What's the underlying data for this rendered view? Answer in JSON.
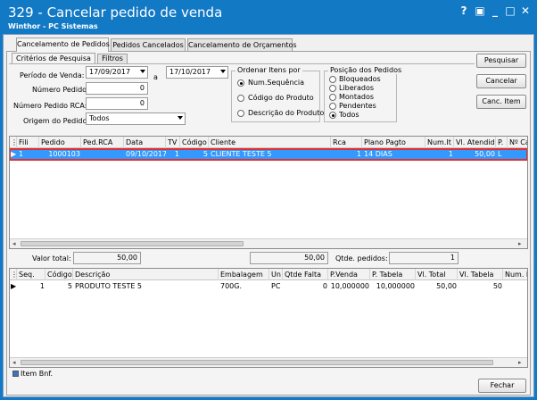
{
  "window": {
    "title": "329 - Cancelar pedido de venda",
    "subtitle": "Winthor - PC Sistemas",
    "controls": {
      "help": "?",
      "restore": "▣",
      "minimize": "_",
      "maximize": "□",
      "close": "✕"
    }
  },
  "tabs": [
    "Cancelamento de Pedidos",
    "Pedidos Cancelados",
    "Cancelamento de Orçamentos"
  ],
  "subtabs": [
    "Critérios de Pesquisa",
    "Filtros"
  ],
  "filters": {
    "periodo_label": "Período de Venda:",
    "date_from": "17/09/2017",
    "date_sep": "a",
    "date_to": "17/10/2017",
    "numero_pedido_label": "Número Pedido:",
    "numero_pedido": "0",
    "numero_pedido_rca_label": "Número Pedido RCA:",
    "numero_pedido_rca": "0",
    "origem_label": "Origem do Pedido:",
    "origem_value": "Todos"
  },
  "ordenar": {
    "title": "Ordenar Itens por",
    "options": [
      "Num.Sequência",
      "Código do Produto",
      "Descrição do Produto"
    ],
    "selected": 0
  },
  "posicao": {
    "title": "Posição dos Pedidos",
    "options": [
      "Bloqueados",
      "Liberados",
      "Montados",
      "Pendentes",
      "Todos"
    ],
    "selected": 4
  },
  "buttons": {
    "pesquisar": "Pesquisar",
    "cancelar": "Cancelar",
    "canc_item": "Canc. Item",
    "fechar": "Fechar"
  },
  "orders_grid": {
    "columns": [
      "Fili",
      "Pedido",
      "Ped.RCA",
      "Data",
      "TV",
      "Código",
      "Cliente",
      "Rca",
      "Plano Pagto",
      "Num.It",
      "Vl. Atendido",
      "P.",
      "Nº Ca"
    ],
    "rows": [
      [
        "1",
        "1000103",
        "",
        "09/10/2017",
        "1",
        "5",
        "CLIENTE TESTE 5",
        "1",
        "14 DIAS",
        "1",
        "50,00",
        "L",
        ""
      ]
    ],
    "highlight_color": "#e03030",
    "selection_color": "#3399ff"
  },
  "totals": {
    "valor_total_label": "Valor total:",
    "valor_total": "50,00",
    "middle_total": "50,00",
    "qtde_pedidos_label": "Qtde. pedidos:",
    "qtde_pedidos": "1"
  },
  "items_grid": {
    "columns": [
      "Seq.",
      "Código",
      "Descrição",
      "Embalagem",
      "Un",
      "Qtde Falta",
      "P.Venda",
      "P. Tabela",
      "Vl. Total",
      "Vl. Tabela",
      "Num. Lo"
    ],
    "rows": [
      [
        "1",
        "5",
        "PRODUTO TESTE 5",
        "700G.",
        "PC",
        "0",
        "10,000000",
        "10,000000",
        "50,00",
        "50",
        ""
      ]
    ]
  },
  "legend": {
    "label": "Item Bnf.",
    "color": "#3a72c8"
  }
}
